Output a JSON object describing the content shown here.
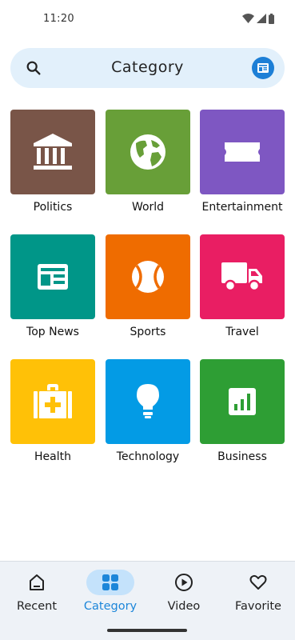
{
  "status_bar": {
    "time": "11:20",
    "icons": [
      "wifi-icon",
      "cellular-signal-icon",
      "battery-icon"
    ]
  },
  "header": {
    "title": "Category",
    "search_icon": "search-icon",
    "action_icon": "newspaper-icon",
    "accent_color": "#1d7fd6"
  },
  "categories": [
    {
      "label": "Politics",
      "icon": "courthouse-icon",
      "color": "#795548"
    },
    {
      "label": "World",
      "icon": "globe-icon",
      "color": "#689f38"
    },
    {
      "label": "Entertainment",
      "icon": "ticket-icon",
      "color": "#7e57c2"
    },
    {
      "label": "Top News",
      "icon": "newspaper-icon",
      "color": "#009688"
    },
    {
      "label": "Sports",
      "icon": "tennis-ball-icon",
      "color": "#ef6c00"
    },
    {
      "label": "Travel",
      "icon": "truck-icon",
      "color": "#e91e63"
    },
    {
      "label": "Health",
      "icon": "medical-bag-icon",
      "color": "#ffc107"
    },
    {
      "label": "Technology",
      "icon": "lightbulb-icon",
      "color": "#039be5"
    },
    {
      "label": "Business",
      "icon": "chart-icon",
      "color": "#2e9e34"
    }
  ],
  "bottom_nav": {
    "items": [
      {
        "label": "Recent",
        "icon": "home-icon",
        "active": false
      },
      {
        "label": "Category",
        "icon": "grid-icon",
        "active": true
      },
      {
        "label": "Video",
        "icon": "play-circle-icon",
        "active": false
      },
      {
        "label": "Favorite",
        "icon": "heart-icon",
        "active": false
      }
    ],
    "active_color": "#1d86d9"
  }
}
